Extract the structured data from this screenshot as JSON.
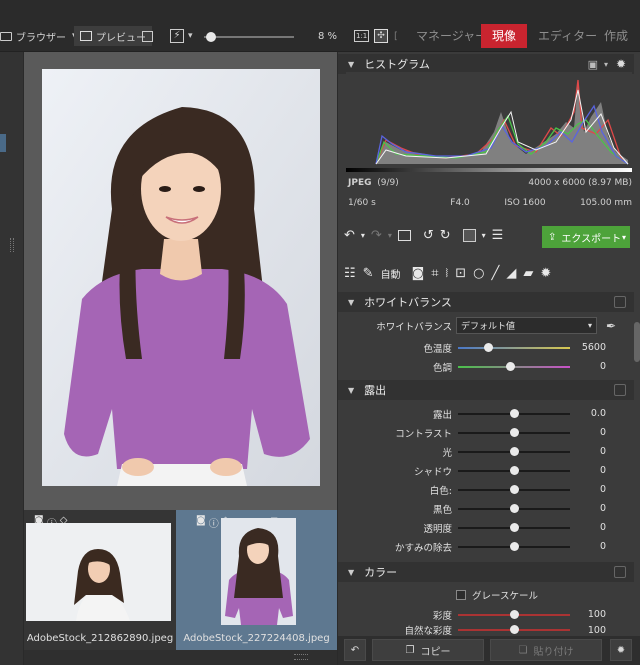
{
  "toolbar": {
    "browser_label": "ブラウザー",
    "preview_label": "プレビュー",
    "zoom_value": "8 %",
    "zoom_fit_label": "1:1",
    "tabs": [
      {
        "label": "マネージャー",
        "active": false
      },
      {
        "label": "現像",
        "active": true
      },
      {
        "label": "エディター",
        "active": false
      },
      {
        "label": "作成",
        "active": false
      }
    ]
  },
  "histogram": {
    "title": "ヒストグラム",
    "format": "JPEG",
    "count": "(9/9)",
    "dimensions": "4000 x 6000 (8.97 MB)",
    "shutter": "1/60 s",
    "aperture": "F4.0",
    "iso": "ISO 1600",
    "focal": "105.00 mm"
  },
  "actions": {
    "export_label": "エクスポート",
    "auto_label": "自動"
  },
  "white_balance": {
    "title": "ホワイトバランス",
    "label": "ホワイトバランス",
    "preset": "デフォルト値",
    "rows": [
      {
        "label": "色温度",
        "value": "5600",
        "pos": 0.27
      },
      {
        "label": "色調",
        "value": "0",
        "pos": 0.47
      }
    ]
  },
  "exposure": {
    "title": "露出",
    "rows": [
      {
        "label": "露出",
        "value": "0.0",
        "pos": 0.5
      },
      {
        "label": "コントラスト",
        "value": "0",
        "pos": 0.5
      },
      {
        "label": "光",
        "value": "0",
        "pos": 0.5
      },
      {
        "label": "シャドウ",
        "value": "0",
        "pos": 0.5
      },
      {
        "label": "白色:",
        "value": "0",
        "pos": 0.5
      },
      {
        "label": "黒色",
        "value": "0",
        "pos": 0.5
      },
      {
        "label": "透明度",
        "value": "0",
        "pos": 0.5
      },
      {
        "label": "かすみの除去",
        "value": "0",
        "pos": 0.5
      }
    ]
  },
  "color": {
    "title": "カラー",
    "grayscale_label": "グレースケール",
    "rows": [
      {
        "label": "彩度",
        "value": "100",
        "pos": 0.5
      },
      {
        "label": "自然な彩度",
        "value": "100",
        "pos": 0.5
      }
    ]
  },
  "filmstrip": {
    "items": [
      {
        "name": "AdobeStock_212862890.jpeg",
        "selected": false
      },
      {
        "name": "AdobeStock_227224408.jpeg",
        "selected": true
      }
    ]
  },
  "bottom": {
    "copy_label": "コピー",
    "paste_label": "貼り付け"
  },
  "colors": {
    "accent_red": "#c9242f",
    "export_green": "#4da33a",
    "selected_thumb": "#5e7890"
  }
}
